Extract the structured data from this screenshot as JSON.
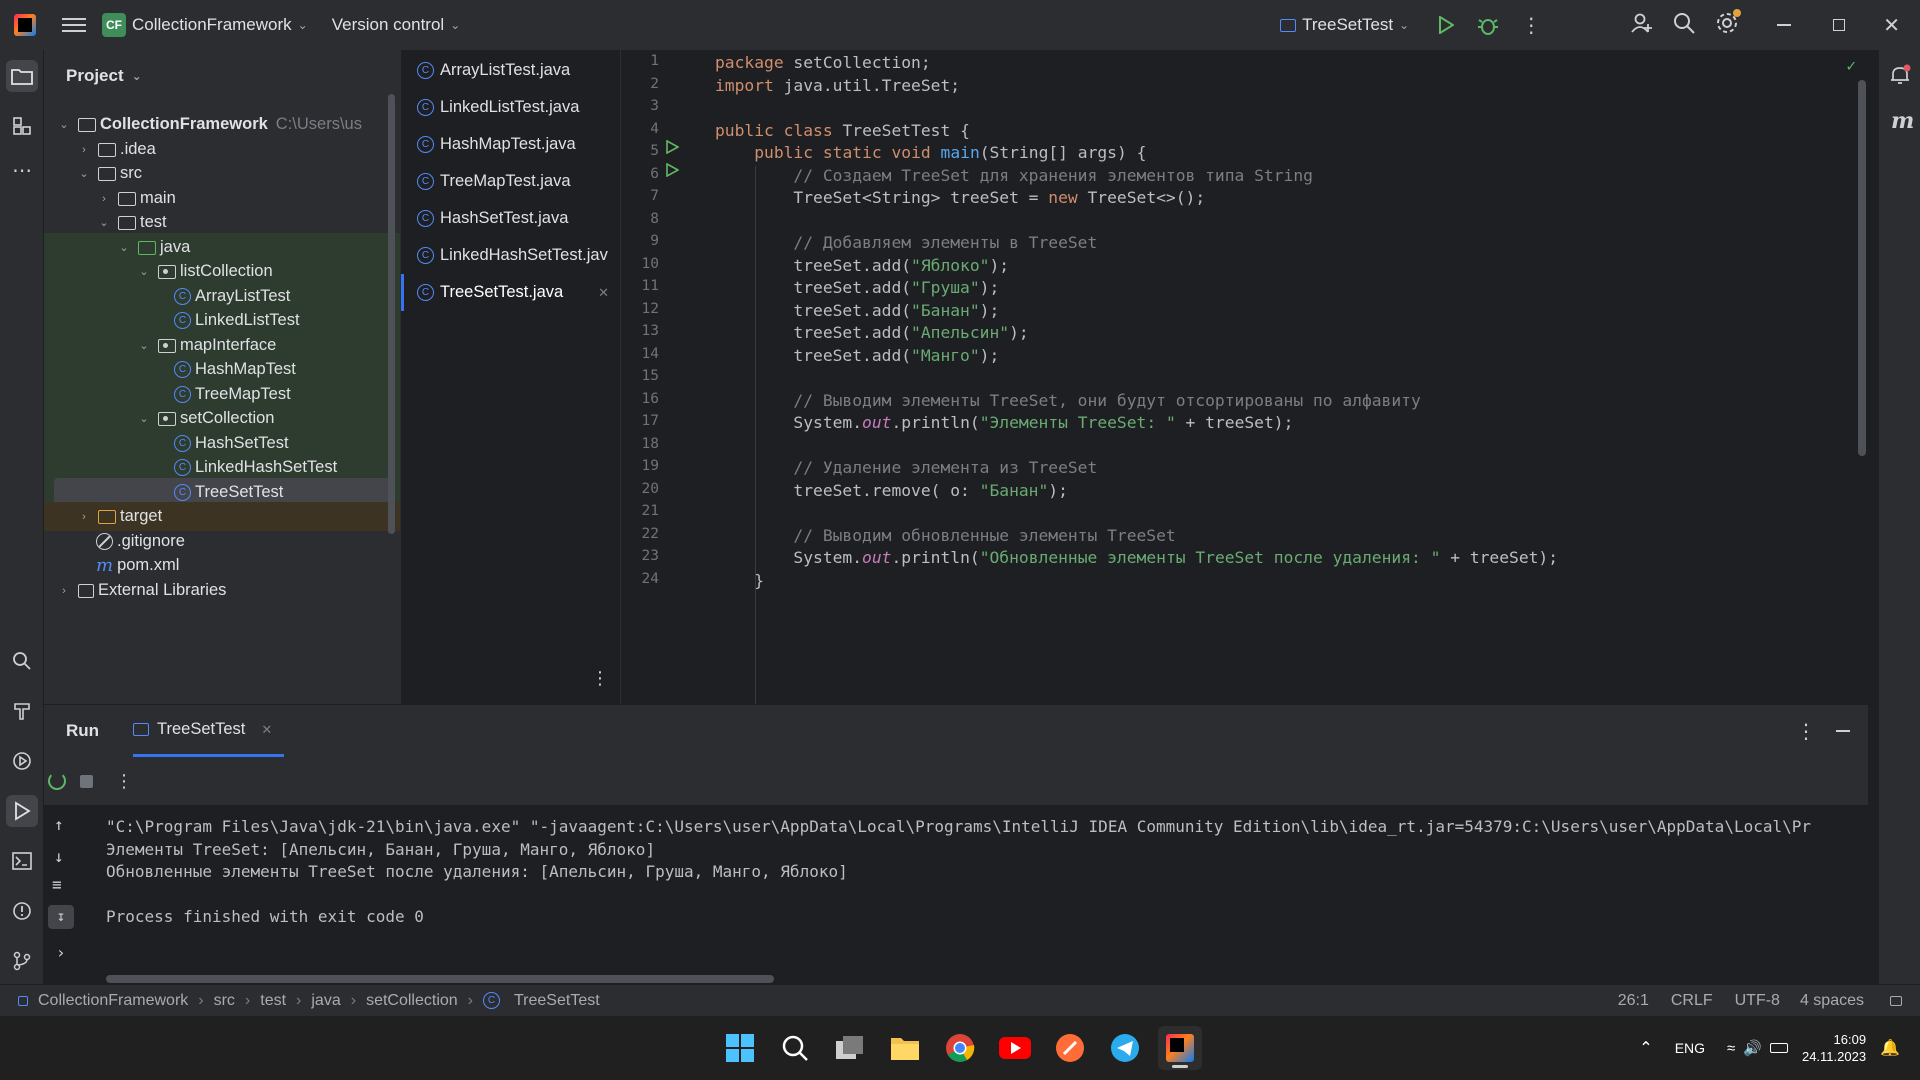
{
  "titlebar": {
    "project_badge": "CF",
    "project_name": "CollectionFramework",
    "vcs_label": "Version control",
    "run_config": "TreeSetTest"
  },
  "project_panel": {
    "title": "Project",
    "tree": [
      {
        "label": "CollectionFramework",
        "suffix": "C:\\Users\\us",
        "kind": "module",
        "expanded": true
      },
      {
        "label": ".idea",
        "kind": "folder",
        "expanded": false
      },
      {
        "label": "src",
        "kind": "folder",
        "expanded": true
      },
      {
        "label": "main",
        "kind": "folder",
        "expanded": false
      },
      {
        "label": "test",
        "kind": "folder",
        "expanded": true
      },
      {
        "label": "java",
        "kind": "folder-green",
        "expanded": true
      },
      {
        "label": "listCollection",
        "kind": "package",
        "expanded": true
      },
      {
        "label": "ArrayListTest",
        "kind": "class"
      },
      {
        "label": "LinkedListTest",
        "kind": "class"
      },
      {
        "label": "mapInterface",
        "kind": "package",
        "expanded": true
      },
      {
        "label": "HashMapTest",
        "kind": "class"
      },
      {
        "label": "TreeMapTest",
        "kind": "class"
      },
      {
        "label": "setCollection",
        "kind": "package",
        "expanded": true
      },
      {
        "label": "HashSetTest",
        "kind": "class"
      },
      {
        "label": "LinkedHashSetTest",
        "kind": "class"
      },
      {
        "label": "TreeSetTest",
        "kind": "class",
        "selected": true
      },
      {
        "label": "target",
        "kind": "folder-orange",
        "expanded": false
      },
      {
        "label": ".gitignore",
        "kind": "file"
      },
      {
        "label": "pom.xml",
        "kind": "maven"
      },
      {
        "label": "External Libraries",
        "kind": "libs",
        "expanded": false
      }
    ]
  },
  "editor_tabs": [
    {
      "label": "ArrayListTest.java"
    },
    {
      "label": "LinkedListTest.java"
    },
    {
      "label": "HashMapTest.java"
    },
    {
      "label": "TreeMapTest.java"
    },
    {
      "label": "HashSetTest.java"
    },
    {
      "label": "LinkedHashSetTest.jav"
    },
    {
      "label": "TreeSetTest.java",
      "active": true
    }
  ],
  "editor": {
    "code_lines": [
      "package setCollection;",
      "import java.util.TreeSet;",
      "",
      "public class TreeSetTest {",
      "    public static void main(String[] args) {",
      "        // Создаем TreeSet для хранения элементов типа String",
      "        TreeSet<String> treeSet = new TreeSet<>();",
      "",
      "        // Добавляем элементы в TreeSet",
      "        treeSet.add(\"Яблоко\");",
      "        treeSet.add(\"Груша\");",
      "        treeSet.add(\"Банан\");",
      "        treeSet.add(\"Апельсин\");",
      "        treeSet.add(\"Манго\");",
      "",
      "        // Выводим элементы TreeSet, они будут отсортированы по алфавиту",
      "        System.out.println(\"Элементы TreeSet: \" + treeSet);",
      "",
      "        // Удаление элемента из TreeSet",
      "        treeSet.remove( o: \"Банан\");",
      "",
      "        // Выводим обновленные элементы TreeSet",
      "        System.out.println(\"Обновленные элементы TreeSet после удаления: \" + treeSet);",
      "    }"
    ],
    "param_hint": "o:"
  },
  "run_panel": {
    "title": "Run",
    "tab_label": "TreeSetTest",
    "console_lines": [
      "\"C:\\Program Files\\Java\\jdk-21\\bin\\java.exe\" \"-javaagent:C:\\Users\\user\\AppData\\Local\\Programs\\IntelliJ IDEA Community Edition\\lib\\idea_rt.jar=54379:C:\\Users\\user\\AppData\\Local\\Pr",
      "Элементы TreeSet: [Апельсин, Банан, Груша, Манго, Яблоко]",
      "Обновленные элементы TreeSet после удаления: [Апельсин, Груша, Манго, Яблоко]",
      "",
      "Process finished with exit code 0"
    ]
  },
  "statusbar": {
    "breadcrumb": [
      "CollectionFramework",
      "src",
      "test",
      "java",
      "setCollection",
      "TreeSetTest"
    ],
    "position": "26:1",
    "line_endings": "CRLF",
    "encoding": "UTF-8",
    "indent": "4 spaces"
  },
  "taskbar": {
    "language": "ENG",
    "time": "16:09",
    "date": "24.11.2023"
  },
  "colors": {
    "accent": "#3574f0",
    "run_green": "#5fb865",
    "keyword": "#cf8e6d",
    "string": "#6aab73",
    "comment": "#7a7e85"
  }
}
